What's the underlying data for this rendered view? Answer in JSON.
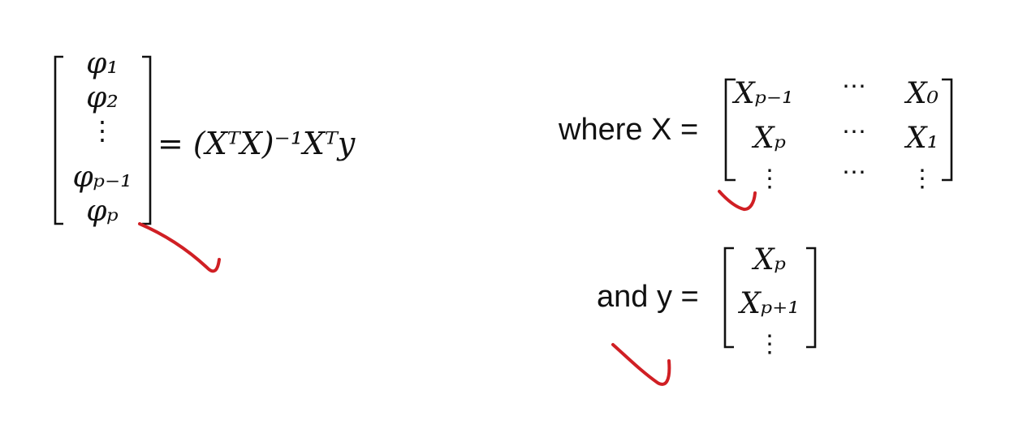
{
  "phi_vector": [
    "φ₁",
    "φ₂",
    "⋮",
    "φₚ₋₁",
    "φₚ"
  ],
  "solution_formula": "= (XᵀX)⁻¹Xᵀy",
  "x_definition": {
    "prefix": "where X =",
    "rows": [
      [
        "Xₚ₋₁",
        "⋯",
        "X₀"
      ],
      [
        "Xₚ",
        "⋯",
        "X₁"
      ],
      [
        "⋮",
        "⋯",
        "⋮"
      ]
    ]
  },
  "y_definition": {
    "prefix": "and y =",
    "rows": [
      "Xₚ",
      "Xₚ₊₁",
      "⋮"
    ]
  },
  "annotation_color": "#d01f24"
}
